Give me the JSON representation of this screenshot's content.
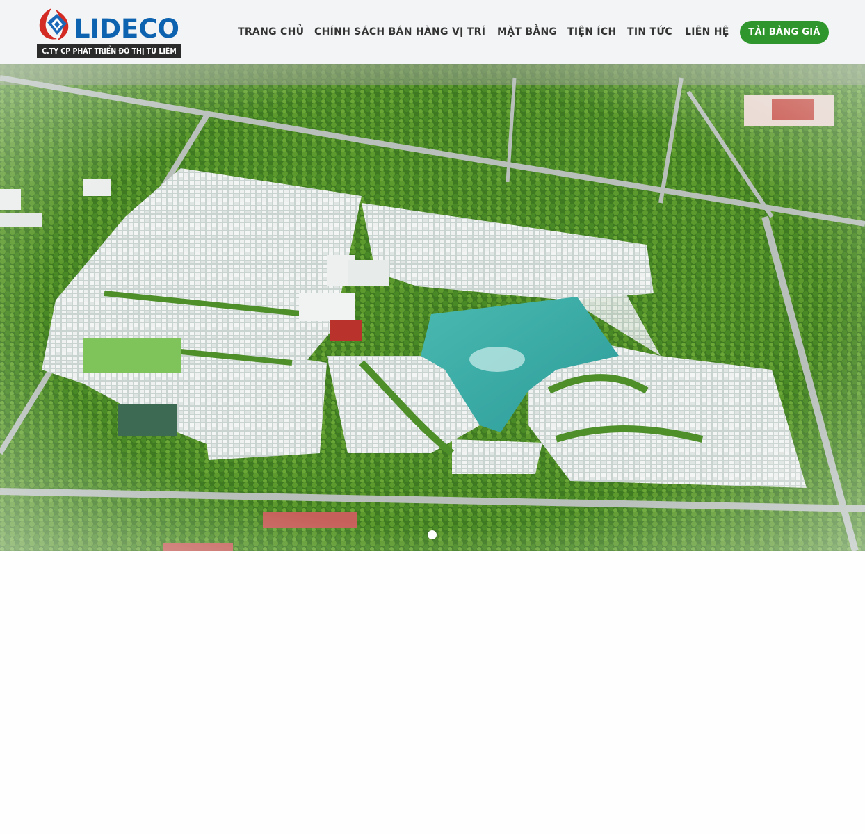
{
  "brand": {
    "logo_text": "LIDECO",
    "tagline": "C.TY CP PHÁT TRIỂN ĐÔ THỊ TỪ LIÊM",
    "logo_icon": "lideco-leaf-logo-icon",
    "primary_color": "#0d63b0",
    "logo_accent": "#d42a24"
  },
  "nav": {
    "items": [
      {
        "label": "TRANG CHỦ"
      },
      {
        "label": "CHÍNH SÁCH BÁN HÀNG"
      },
      {
        "label": "VỊ TRÍ"
      },
      {
        "label": "MẶT BẰNG"
      },
      {
        "label": "TIỆN ÍCH"
      },
      {
        "label": "TIN TỨC"
      },
      {
        "label": "LIÊN HỆ"
      }
    ],
    "cta_label": "TẢI BẢNG GIÁ",
    "cta_color": "#2e962d"
  },
  "hero": {
    "image_description_icon": "aerial-masterplan-image",
    "slide_count": 1,
    "active_slide": 1
  }
}
